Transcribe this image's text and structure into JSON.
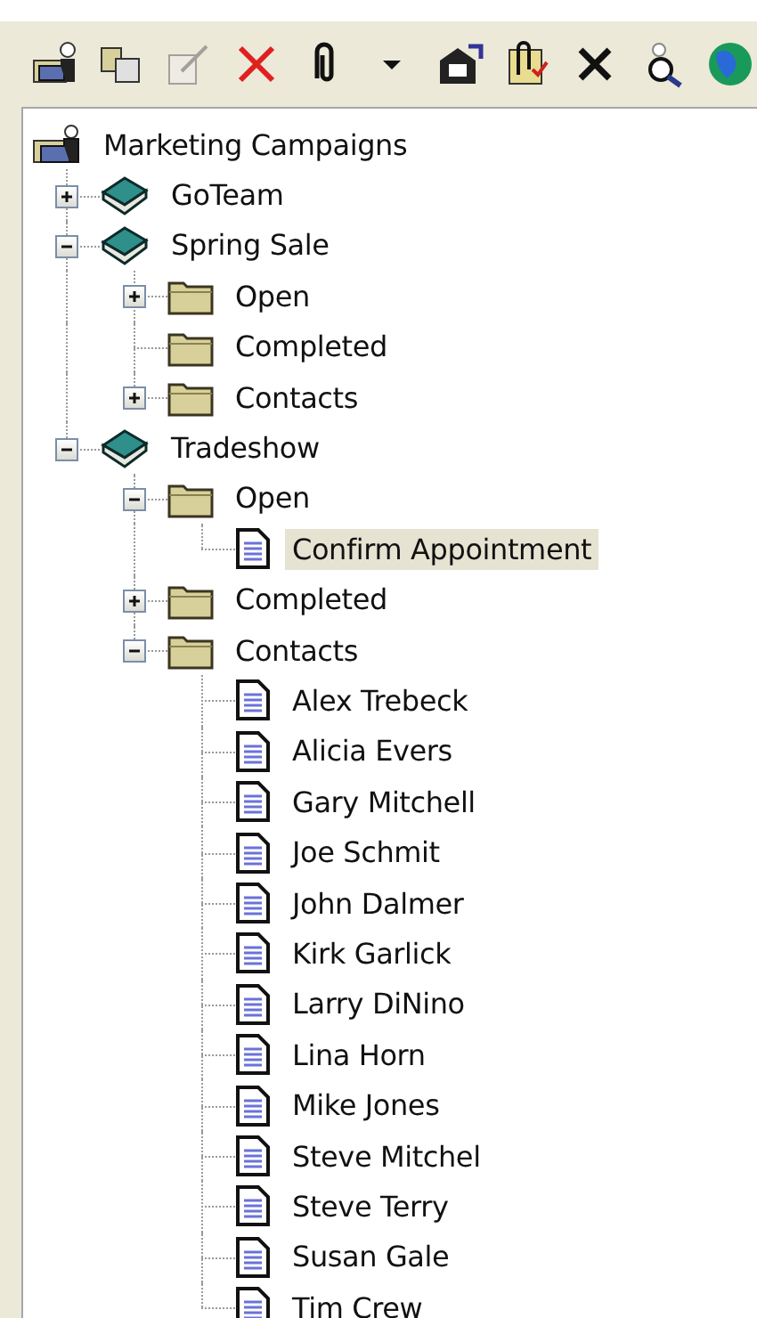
{
  "tree": {
    "label": "Marketing Campaigns",
    "kind": "root",
    "selected": false,
    "children": [
      {
        "label": "GoTeam",
        "kind": "campaign",
        "expanded": false,
        "selected": false
      },
      {
        "label": "Spring Sale",
        "kind": "campaign",
        "expanded": true,
        "selected": false,
        "children": [
          {
            "label": "Open",
            "kind": "folder",
            "expanded": false,
            "selected": false
          },
          {
            "label": "Completed",
            "kind": "folder",
            "selected": false
          },
          {
            "label": "Contacts",
            "kind": "folder",
            "expanded": false,
            "selected": false
          }
        ]
      },
      {
        "label": "Tradeshow",
        "kind": "campaign",
        "expanded": true,
        "selected": false,
        "children": [
          {
            "label": "Open",
            "kind": "folder",
            "expanded": true,
            "selected": false,
            "children": [
              {
                "label": "Confirm Appointment",
                "kind": "document",
                "selected": true
              }
            ]
          },
          {
            "label": "Completed",
            "kind": "folder",
            "expanded": false,
            "selected": false
          },
          {
            "label": "Contacts",
            "kind": "folder",
            "expanded": true,
            "selected": false,
            "children": [
              {
                "label": "Alex Trebeck",
                "kind": "document",
                "selected": false
              },
              {
                "label": "Alicia Evers",
                "kind": "document",
                "selected": false
              },
              {
                "label": "Gary Mitchell",
                "kind": "document",
                "selected": false
              },
              {
                "label": "Joe Schmit",
                "kind": "document",
                "selected": false
              },
              {
                "label": "John Dalmer",
                "kind": "document",
                "selected": false
              },
              {
                "label": "Kirk Garlick",
                "kind": "document",
                "selected": false
              },
              {
                "label": "Larry DiNino",
                "kind": "document",
                "selected": false
              },
              {
                "label": "Lina Horn",
                "kind": "document",
                "selected": false
              },
              {
                "label": "Mike Jones",
                "kind": "document",
                "selected": false
              },
              {
                "label": "Steve Mitchel",
                "kind": "document",
                "selected": false
              },
              {
                "label": "Steve Terry",
                "kind": "document",
                "selected": false
              },
              {
                "label": "Susan Gale",
                "kind": "document",
                "selected": false
              },
              {
                "label": "Tim Crew",
                "kind": "document",
                "selected": false
              }
            ]
          }
        ]
      }
    ]
  }
}
